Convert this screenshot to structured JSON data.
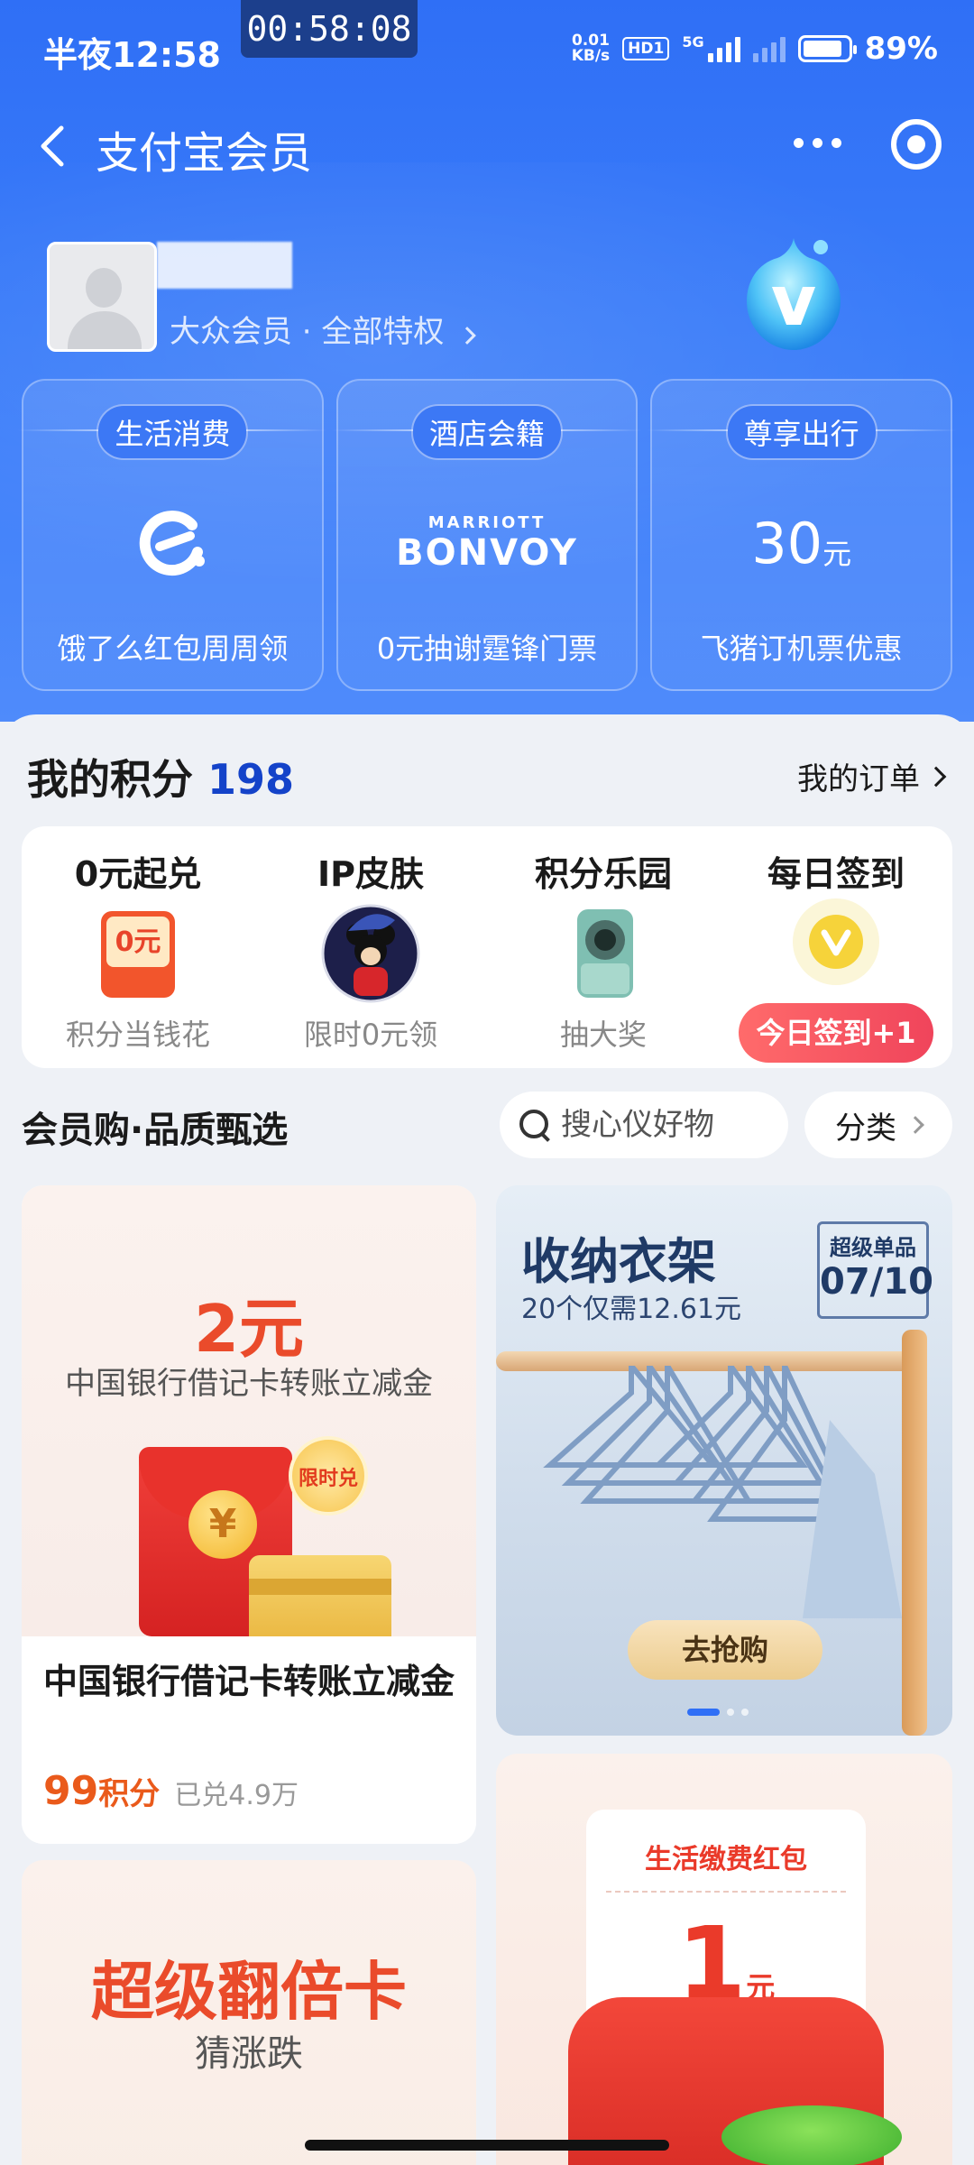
{
  "status_bar": {
    "time": "半夜12:58",
    "timer": "00:58:08",
    "network_speed_value": "0.01",
    "network_speed_unit": "KB/s",
    "hd_label": "HD1",
    "signal_label": "5G",
    "battery": "89%",
    "battery_level": 0.89
  },
  "nav": {
    "title": "支付宝会员"
  },
  "profile": {
    "member_level": "大众会员 · 全部特权"
  },
  "perks": [
    {
      "tag": "生活消费",
      "logo": "eleme-icon",
      "desc": "饿了么红包周周领"
    },
    {
      "tag": "酒店会籍",
      "logo_small": "MARRIOTT",
      "logo_big": "BONVOY",
      "desc": "0元抽谢霆锋门票"
    },
    {
      "tag": "尊享出行",
      "price": "30",
      "unit": "元",
      "desc": "飞猪订机票优惠"
    }
  ],
  "points": {
    "label": "我的积分",
    "value": "198",
    "orders_link": "我的订单"
  },
  "points_items": [
    {
      "title": "0元起兑",
      "sub": "积分当钱花",
      "img_label": "0元"
    },
    {
      "title": "IP皮肤",
      "sub": "限时0元领"
    },
    {
      "title": "积分乐园",
      "sub": "抽大奖"
    },
    {
      "title": "每日签到",
      "button": "今日签到+1"
    }
  ],
  "shop": {
    "title": "会员购·品质甄选",
    "search_placeholder": "搜心仪好物",
    "category_label": "分类"
  },
  "products": {
    "bank": {
      "amount": "2元",
      "subtitle": "中国银行借记卡转账立减金",
      "badge": "限时兑",
      "coin": "¥",
      "name": "中国银行借记卡转账立减金",
      "points": "99",
      "points_unit": "积分",
      "redeemed": "已兑4.9万"
    },
    "hanger": {
      "title": "收纳衣架",
      "subtitle": "20个仅需12.61元",
      "badge_top": "超级单品",
      "badge_date": "07/10",
      "button": "去抢购"
    },
    "double_card": {
      "title": "超级翻倍卡",
      "subtitle": "猜涨跌"
    },
    "utility": {
      "title": "生活缴费红包",
      "amount": "1",
      "unit": "元"
    }
  },
  "colors": {
    "header_blue": "#2f6ff6",
    "points_blue": "#1443c9",
    "accent_orange": "#ea4b2b",
    "signin_red": "#f0445b"
  }
}
